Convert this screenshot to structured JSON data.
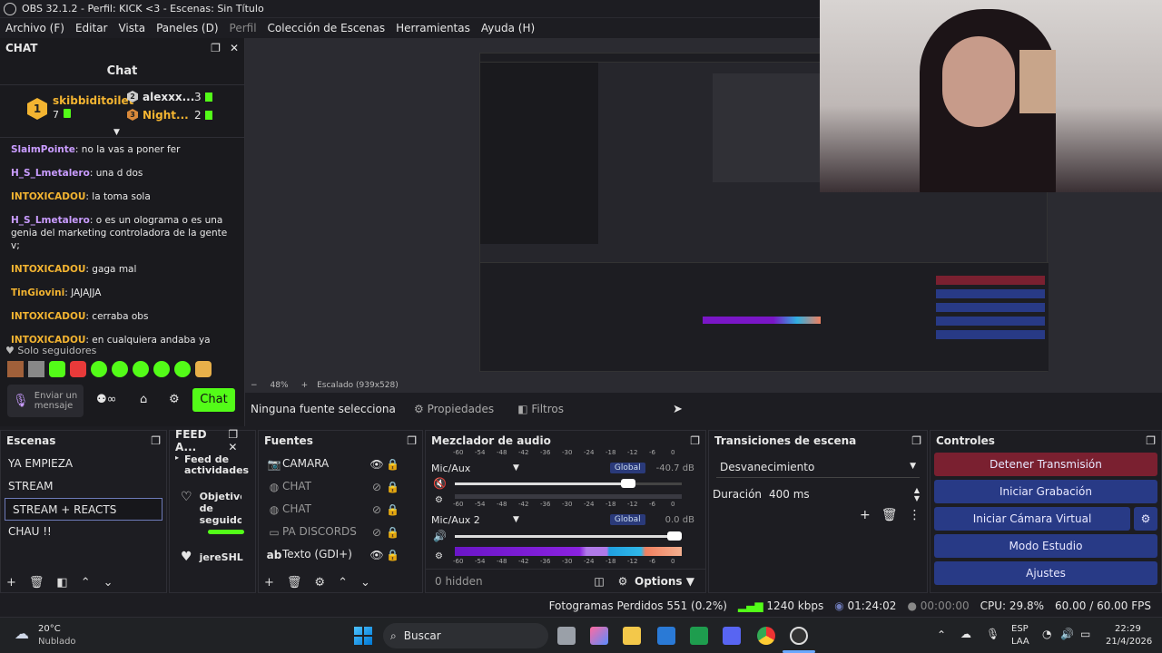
{
  "window": {
    "title": "OBS 32.1.2 - Perfil: KICK <3 - Escenas: Sin Título"
  },
  "menu": {
    "items": [
      "Archivo (F)",
      "Editar",
      "Vista",
      "Paneles (D)",
      "Perfil",
      "Colección de Escenas",
      "Herramientas",
      "Ayuda (H)"
    ]
  },
  "chat": {
    "dock_title": "CHAT",
    "header": "Chat",
    "leaders": [
      {
        "rank": "1",
        "name": "skibbiditoilet",
        "count": "7"
      },
      {
        "rank": "2",
        "name": "alexxx...",
        "count": "3"
      },
      {
        "rank": "3",
        "name": "Night...",
        "count": "2"
      }
    ],
    "messages": [
      {
        "user": "SlaimPointe",
        "color": "#c99cff",
        "text": ": no la vas a poner fer"
      },
      {
        "user": "H_S_Lmetalero",
        "color": "#c99cff",
        "text": ": una d dos"
      },
      {
        "user": "INTOXICADOU",
        "color": "#f3b431",
        "text": ": la toma sola"
      },
      {
        "user": "H_S_Lmetalero",
        "color": "#c99cff",
        "text": ": o es un olograma o es una genia del marketing controladora de la gente v;"
      },
      {
        "user": "INTOXICADOU",
        "color": "#f3b431",
        "text": ": gaga mal"
      },
      {
        "user": "TinGiovini",
        "color": "#f3b431",
        "text": ": JAJAJJA"
      },
      {
        "user": "INTOXICADOU",
        "color": "#f3b431",
        "text": ": cerraba obs"
      },
      {
        "user": "INTOXICADOU",
        "color": "#f3b431",
        "text": ": en cualquiera andaba ya"
      }
    ],
    "followers_only": "Solo seguidores",
    "send_placeholder": "Enviar un mensaje",
    "chat_button": "Chat"
  },
  "preview": {
    "zoom": "48%",
    "scaling": "Escalado (939x528)"
  },
  "source_bar": {
    "no_source": "Ninguna fuente selecciona",
    "properties": "Propiedades",
    "filters": "Filtros"
  },
  "scenes": {
    "title": "Escenas",
    "items": [
      "YA EMPIEZA",
      "STREAM",
      "STREAM + REACTS",
      "CHAU !!"
    ],
    "selected_index": 2
  },
  "feed": {
    "title": "FEED A...",
    "item1": "Feed de actividades",
    "item2": "Objetivo de seguido",
    "item3": "jereSHL"
  },
  "sources": {
    "title": "Fuentes",
    "items": [
      "CAMARA",
      "CHAT",
      "CHAT",
      "PA DISCORDS",
      "Texto (GDI+)"
    ]
  },
  "mixer": {
    "title": "Mezclador de audio",
    "ticks": [
      "-60",
      "-54",
      "-48",
      "-42",
      "-36",
      "-30",
      "-24",
      "-18",
      "-12",
      "-6",
      "0"
    ],
    "channels": [
      {
        "name": "Mic/Aux",
        "badge": "Global",
        "db": "-40.7 dB",
        "volume": 0.78
      },
      {
        "name": "Mic/Aux 2",
        "badge": "Global",
        "db": "0.0 dB",
        "volume": 1.0
      }
    ],
    "hidden": "0 hidden",
    "options": "Options"
  },
  "transitions": {
    "title": "Transiciones de escena",
    "selected": "Desvanecimiento",
    "duration_label": "Duración",
    "duration_value": "400 ms"
  },
  "controls": {
    "title": "Controles",
    "buttons": [
      "Detener Transmisión",
      "Iniciar Grabación",
      "Iniciar Cámara Virtual",
      "Modo Estudio",
      "Ajustes"
    ]
  },
  "status": {
    "dropped": "Fotogramas Perdidos 551 (0.2%)",
    "bitrate": "1240 kbps",
    "stream_time": "01:24:02",
    "rec_time": "00:00:00",
    "cpu": "CPU: 29.8%",
    "fps": "60.00 / 60.00 FPS"
  },
  "taskbar": {
    "weather_temp": "20°C",
    "weather_desc": "Nublado",
    "search": "Buscar",
    "lang1": "ESP",
    "lang2": "LAA",
    "time": "22:29",
    "date": "21/4/2026"
  },
  "colors": {
    "accent": "#53fc18",
    "stop": "#7a2030",
    "control": "#283a86"
  }
}
